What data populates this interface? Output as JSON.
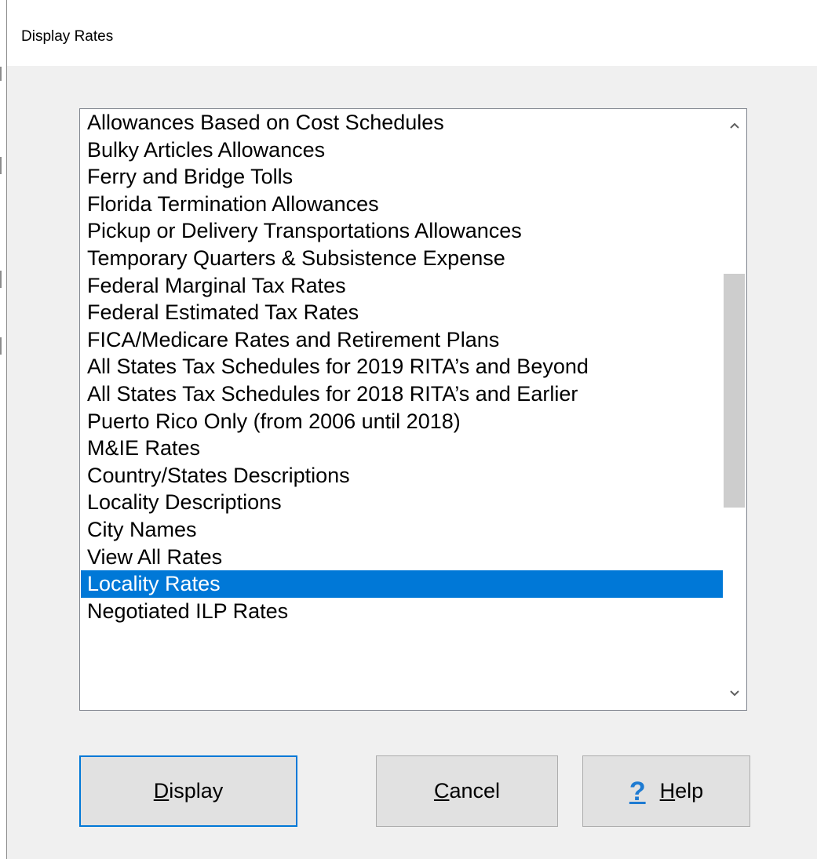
{
  "window": {
    "title": "Display Rates"
  },
  "listbox": {
    "items": [
      "Allowances Based on Cost Schedules",
      "Bulky Articles Allowances",
      "Ferry and Bridge Tolls",
      "Florida Termination Allowances",
      "Pickup or Delivery Transportations Allowances",
      "Temporary Quarters & Subsistence Expense",
      "Federal Marginal Tax Rates",
      "Federal Estimated Tax Rates",
      "FICA/Medicare Rates and Retirement Plans",
      "All States Tax Schedules for 2019 RITA’s and Beyond",
      "All States Tax Schedules for 2018 RITA’s and Earlier",
      "Puerto Rico Only (from 2006 until 2018)",
      "M&IE Rates",
      "Country/States Descriptions",
      "Locality Descriptions",
      "City Names",
      "View All Rates",
      "Locality Rates",
      "Negotiated ILP Rates"
    ],
    "selected_index": 17,
    "scroll_up_icon": "chevron-up-icon",
    "scroll_down_icon": "chevron-down-icon"
  },
  "buttons": {
    "display": {
      "mnemonic": "D",
      "rest": "isplay"
    },
    "cancel": {
      "mnemonic": "C",
      "rest": "ancel"
    },
    "help": {
      "icon_glyph": "?",
      "icon": "help-question-icon",
      "mnemonic": "H",
      "rest": "elp"
    }
  },
  "colors": {
    "selection": "#0078d7",
    "help_icon": "#1e7bd2",
    "default_button_border": "#0078d7",
    "dialog_background": "#f0f0f0"
  }
}
